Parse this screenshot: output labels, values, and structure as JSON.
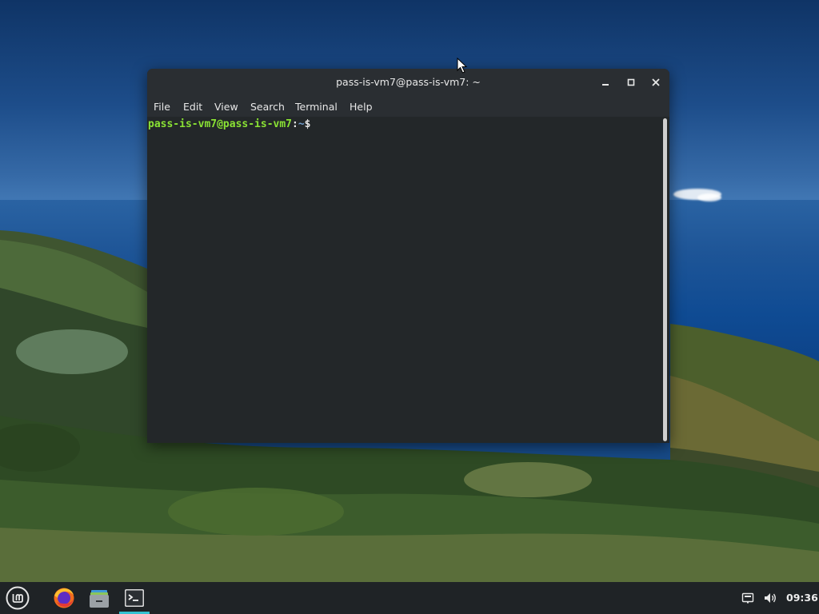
{
  "window": {
    "title": "pass-is-vm7@pass-is-vm7: ~",
    "controls": [
      "minimize-icon",
      "maximize-icon",
      "close-icon"
    ]
  },
  "menu": {
    "file": "File",
    "edit": "Edit",
    "view": "View",
    "search": "Search",
    "terminal": "Terminal",
    "help": "Help"
  },
  "terminal": {
    "prompt_user": "pass-is-vm7@pass-is-vm7",
    "prompt_sep": ":",
    "prompt_path": "~",
    "prompt_symbol": "$"
  },
  "taskbar": {
    "launchers": [
      "mint-menu-icon",
      "firefox-icon",
      "files-icon",
      "terminal-icon"
    ],
    "tray": [
      "network-icon",
      "volume-icon"
    ],
    "clock": "09:36"
  },
  "colors": {
    "prompt_user": "#8ae234",
    "prompt_path": "#729fcf",
    "terminal_bg": "#232729",
    "active_indicator": "#35c2d2"
  }
}
